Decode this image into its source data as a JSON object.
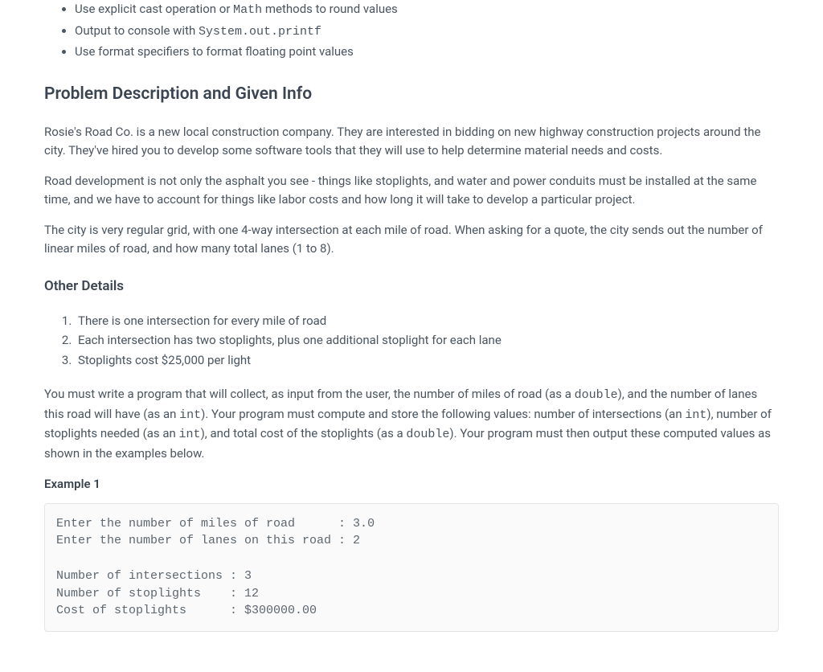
{
  "bullets": {
    "b1_pre": "Use explicit cast operation or ",
    "b1_code": "Math",
    "b1_post": " methods to round values",
    "b2_pre": "Output to console with ",
    "b2_code": "System.out.printf",
    "b3": "Use format specifiers to format floating point values"
  },
  "heading1": "Problem Description and Given Info",
  "para1": "Rosie's Road Co. is a new local construction company. They are interested in bidding on new highway construction projects around the city. They've hired you to develop some software tools that they will use to help determine material needs and costs.",
  "para2": "Road development is not only the asphalt you see - things like stoplights, and water and power conduits must be installed at the same time, and we have to account for things like labor costs and how long it will take to develop a particular project.",
  "para3": "The city is very regular grid, with one 4-way intersection at each mile of road. When asking for a quote, the city sends out the number of linear miles of road, and how many total lanes (1 to 8).",
  "heading2": "Other Details",
  "olist": {
    "i1": "There is one intersection for every mile of road",
    "i2": "Each intersection has two stoplights, plus one additional stoplight for each lane",
    "i3": "Stoplights cost $25,000 per light"
  },
  "para4": {
    "t1": "You must write a program that will collect, as input from the user, the number of miles of road (as a ",
    "c1": "double",
    "t2": "), and the number of lanes this road will have (as an ",
    "c2": "int",
    "t3": "). Your program must compute and store the following values: number of intersections (an ",
    "c3": "int",
    "t4": "), number of stoplights needed (as an ",
    "c4": "int",
    "t5": "), and total cost of the stoplights (as a ",
    "c5": "double",
    "t6": "). Your program must then output these computed values as shown in the examples below."
  },
  "example_label": "Example 1",
  "example_code": "Enter the number of miles of road      : 3.0\nEnter the number of lanes on this road : 2\n\nNumber of intersections : 3\nNumber of stoplights    : 12\nCost of stoplights      : $300000.00"
}
